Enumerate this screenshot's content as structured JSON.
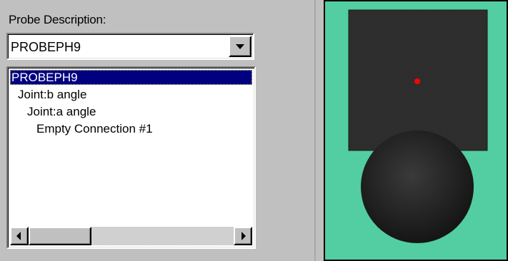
{
  "probe_panel": {
    "label": "Probe Description:",
    "selected_probe": "PROBEPH9"
  },
  "tree": {
    "items": [
      "PROBEPH9",
      "Joint:b angle",
      "Joint:a angle",
      "Empty Connection #1"
    ],
    "selected_index": 0
  },
  "preview": {
    "background_color": "#52cea2",
    "frame_color": "#000000",
    "body_color": "#2d2d2d",
    "sphere_color": "#1e1e1e",
    "marker_color": "#ff0000"
  }
}
